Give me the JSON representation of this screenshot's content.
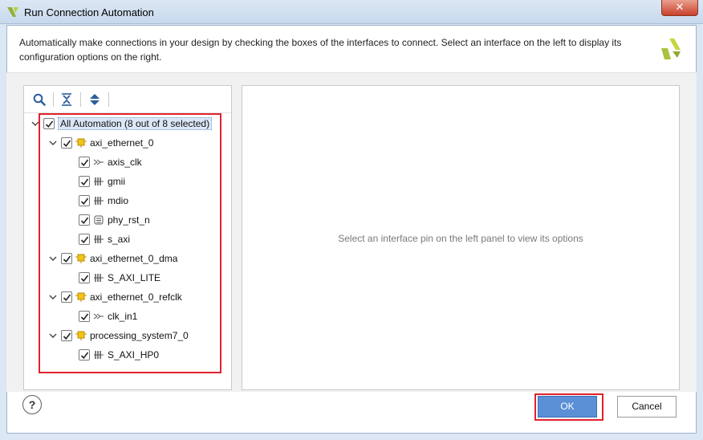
{
  "window": {
    "title": "Run Connection Automation",
    "close_label": "✕"
  },
  "description": "Automatically make connections in your design by checking the boxes of the interfaces to connect. Select an interface on the left to display its configuration options on the right.",
  "toolbar": {
    "icons": [
      "search-icon",
      "collapse-all-icon",
      "expand-all-icon"
    ]
  },
  "tree": {
    "root": {
      "label": "All Automation (8 out of 8 selected)",
      "checked": true
    },
    "groups": [
      {
        "label": "axi_ethernet_0",
        "icon": "ip-block-icon",
        "checked": true,
        "children": [
          {
            "label": "axis_clk",
            "icon": "clock-pin-icon",
            "checked": true
          },
          {
            "label": "gmii",
            "icon": "bus-interface-icon",
            "checked": true
          },
          {
            "label": "mdio",
            "icon": "bus-interface-icon",
            "checked": true
          },
          {
            "label": "phy_rst_n",
            "icon": "reset-pin-icon",
            "checked": true
          },
          {
            "label": "s_axi",
            "icon": "bus-interface-icon",
            "checked": true
          }
        ]
      },
      {
        "label": "axi_ethernet_0_dma",
        "icon": "ip-block-icon",
        "checked": true,
        "children": [
          {
            "label": "S_AXI_LITE",
            "icon": "bus-interface-icon",
            "checked": true
          }
        ]
      },
      {
        "label": "axi_ethernet_0_refclk",
        "icon": "ip-block-icon",
        "checked": true,
        "children": [
          {
            "label": "clk_in1",
            "icon": "clock-pin-icon",
            "checked": true
          }
        ]
      },
      {
        "label": "processing_system7_0",
        "icon": "ip-block-icon",
        "checked": true,
        "children": [
          {
            "label": "S_AXI_HP0",
            "icon": "bus-interface-icon",
            "checked": true
          }
        ]
      }
    ]
  },
  "right_panel": {
    "placeholder": "Select an interface pin on the left panel to view its options"
  },
  "footer": {
    "help_label": "?",
    "ok_label": "OK",
    "cancel_label": "Cancel"
  },
  "colors": {
    "highlight": "#e0222b",
    "ok_button": "#5b8fd6",
    "window_chrome": "#dbe7f4"
  }
}
